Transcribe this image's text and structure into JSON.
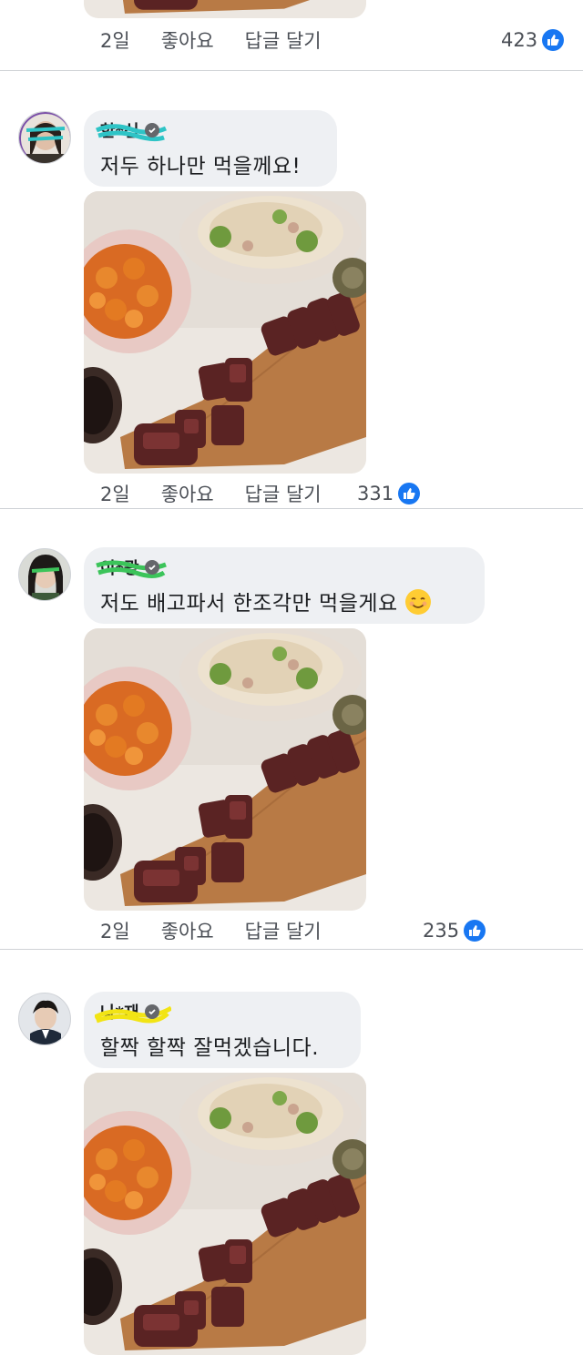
{
  "comments": [
    {
      "actions": {
        "time": "2일",
        "like": "좋아요",
        "reply": "답글 달기"
      },
      "reactions": "423"
    },
    {
      "username": "한*신",
      "text": "저두 하나만 먹을께요!",
      "actions": {
        "time": "2일",
        "like": "좋아요",
        "reply": "답글 달기"
      },
      "reactions": "331"
    },
    {
      "username": "이*광",
      "text": "저도 배고파서 한조각만 먹을게요",
      "emoji": "smiling-face-emoji",
      "actions": {
        "time": "2일",
        "like": "좋아요",
        "reply": "답글 달기"
      },
      "reactions": "235"
    },
    {
      "username": "나*재",
      "text": "할짝 할짝 잘먹겠습니다."
    }
  ],
  "colors": {
    "like_blue": "#1877f2",
    "bubble_bg": "#eef0f3",
    "wood": "#b87a45"
  },
  "icons": {
    "verified": "verified-badge-icon",
    "like": "thumbs-up-icon"
  }
}
